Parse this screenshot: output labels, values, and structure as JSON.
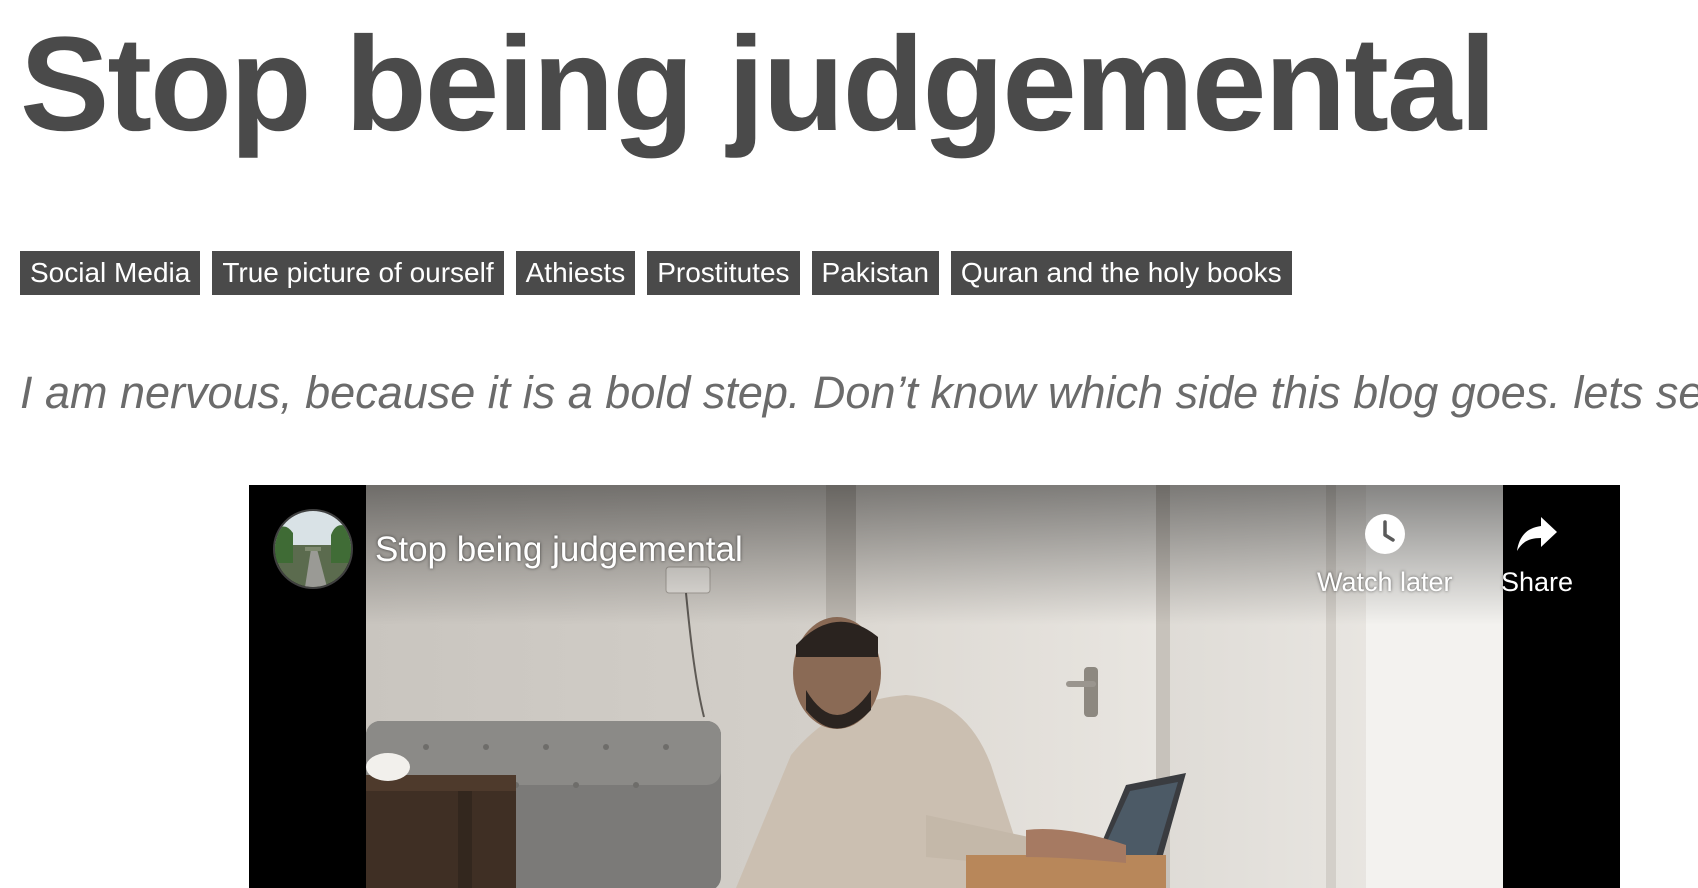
{
  "post": {
    "title": "Stop being judgemental",
    "excerpt": "I am nervous, because it is a bold step. Don’t know which side this blog goes. lets see."
  },
  "tags": [
    "Social Media",
    "True picture of ourself",
    "Athiests",
    "Prostitutes",
    "Pakistan",
    "Quran and the holy books"
  ],
  "video": {
    "title": "Stop being judgemental",
    "channel_avatar_icon": "channel-avatar-road-trees",
    "watch_later_label": "Watch later",
    "watch_later_icon": "clock-icon",
    "share_label": "Share",
    "share_icon": "share-arrow-icon"
  }
}
